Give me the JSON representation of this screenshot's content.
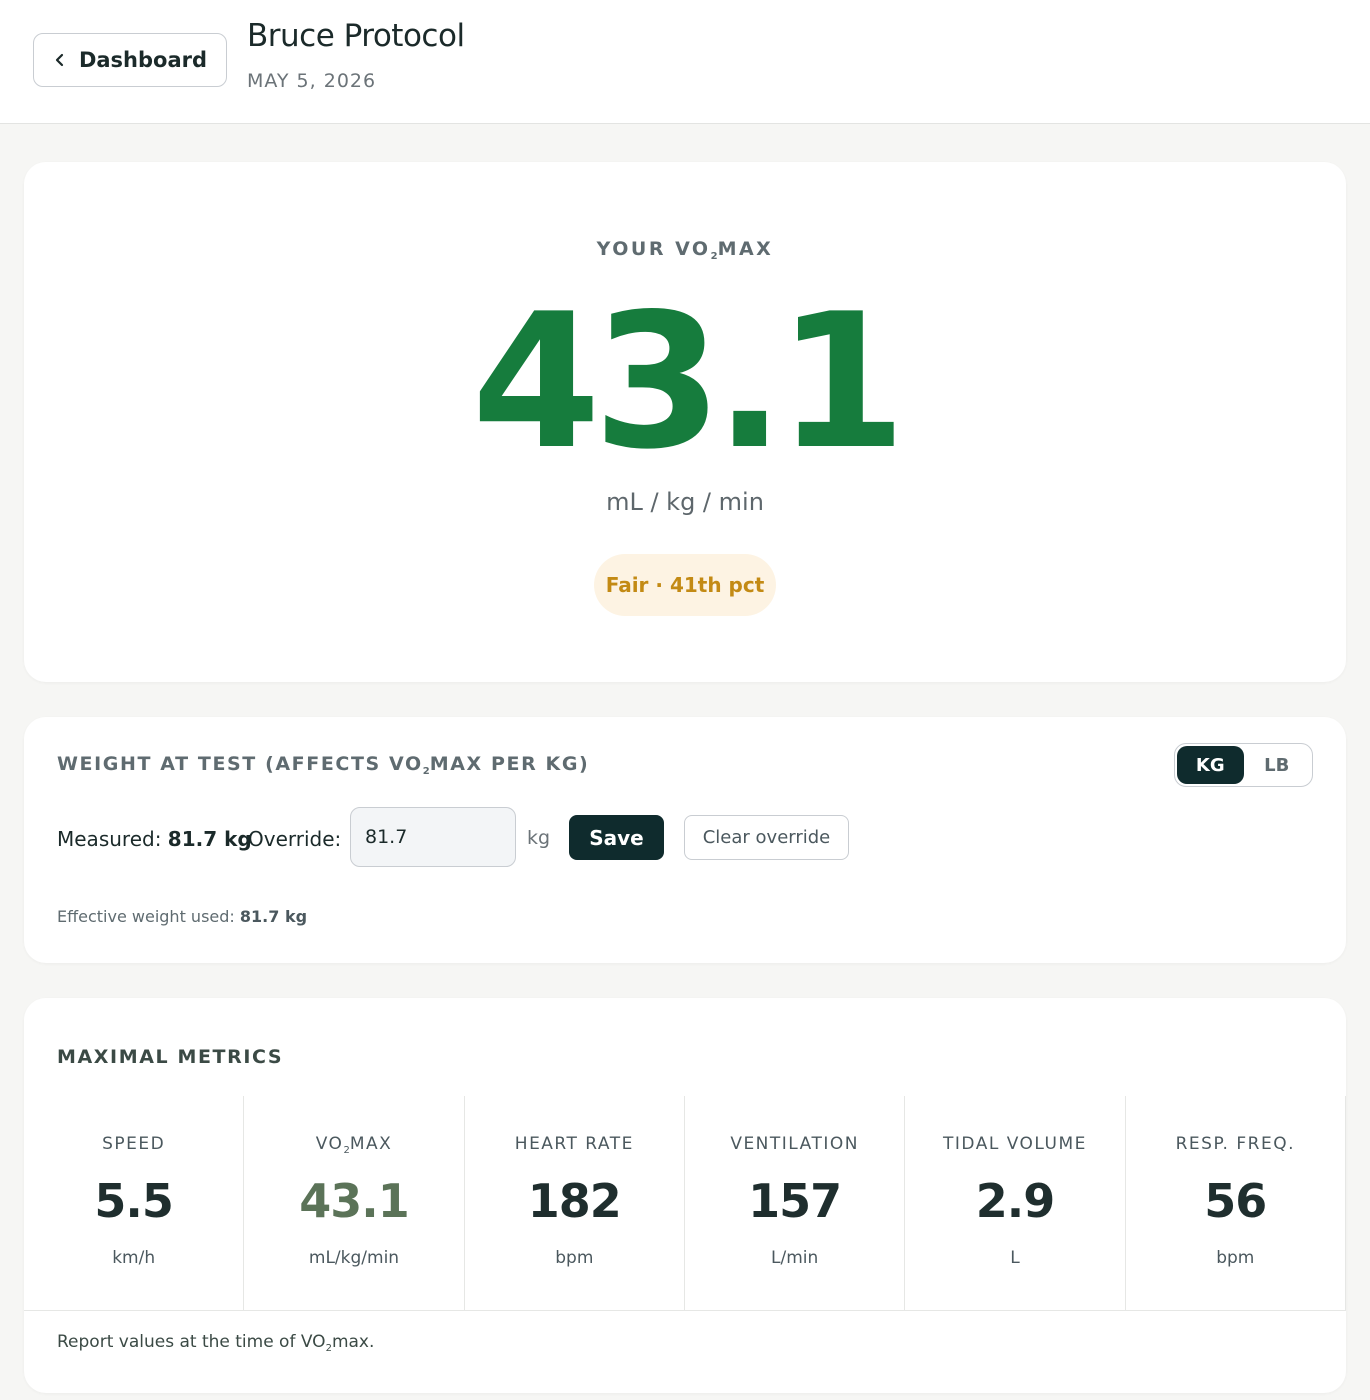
{
  "header": {
    "back_label": "Dashboard",
    "title": "Bruce Protocol",
    "date": "MAY 5, 2026"
  },
  "hero": {
    "label_prefix": "YOUR VO",
    "label_sub": "2",
    "label_suffix": "MAX",
    "value": "43.1",
    "unit": "mL / kg / min",
    "badge": "Fair · 41th pct",
    "accent_color": "#167c3d",
    "badge_color": "#c38a14"
  },
  "weight": {
    "label_prefix": "WEIGHT AT TEST (AFFECTS VO",
    "label_sub": "2",
    "label_suffix": "MAX PER KG)",
    "units": [
      "KG",
      "LB"
    ],
    "active_unit": "KG",
    "measured_label": "Measured:",
    "measured_value": "81.7 kg",
    "override_label": "Override:",
    "override_value": "81.7",
    "override_suffix": "kg",
    "save_label": "Save",
    "clear_label": "Clear override",
    "effective_label": "Effective weight used:",
    "effective_value": "81.7 kg"
  },
  "metrics": {
    "title": "MAXIMAL METRICS",
    "items": [
      {
        "label": "SPEED",
        "value": "5.5",
        "unit": "km/h"
      },
      {
        "label_prefix": "VO",
        "label_sub": "2",
        "label_suffix": "MAX",
        "value": "43.1",
        "unit": "mL/kg/min"
      },
      {
        "label": "HEART RATE",
        "value": "182",
        "unit": "bpm"
      },
      {
        "label": "VENTILATION",
        "value": "157",
        "unit": "L/min"
      },
      {
        "label": "TIDAL VOLUME",
        "value": "2.9",
        "unit": "L"
      },
      {
        "label": "RESP. FREQ.",
        "value": "56",
        "unit": "bpm"
      }
    ],
    "footnote_prefix": "Report values at the time of VO",
    "footnote_sub": "2",
    "footnote_suffix": "max."
  }
}
